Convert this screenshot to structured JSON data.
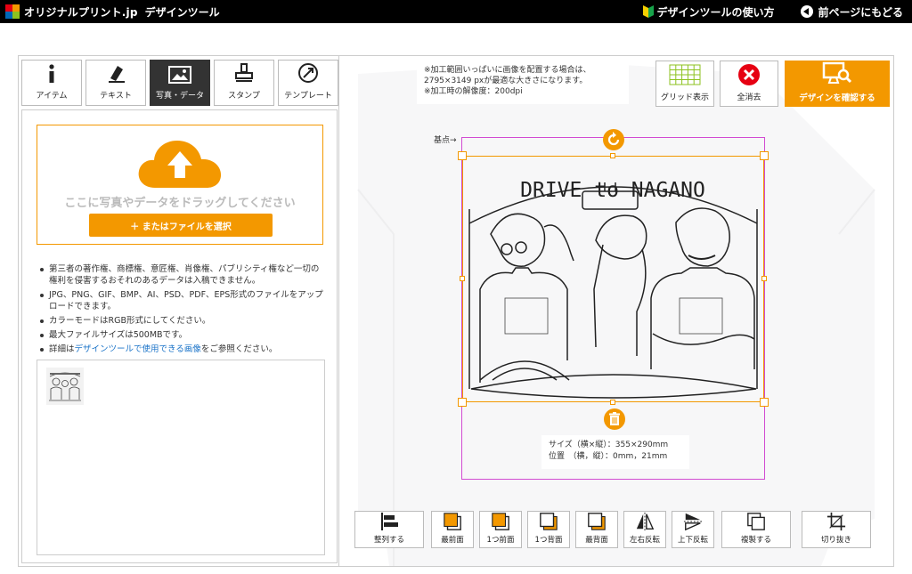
{
  "header": {
    "logo_text": "オリジナルプリント.jp",
    "logo_sub": "デザインツール",
    "guide_link": "デザインツールの使い方",
    "back_link": "前ページにもどる"
  },
  "tabs": [
    {
      "label": "アイテム",
      "icon": "info-icon"
    },
    {
      "label": "テキスト",
      "icon": "pen-icon"
    },
    {
      "label": "写真・データ",
      "icon": "image-icon",
      "active": true
    },
    {
      "label": "スタンプ",
      "icon": "stamp-icon"
    },
    {
      "label": "テンプレート",
      "icon": "template-icon"
    }
  ],
  "upload": {
    "drop_text": "ここに写真やデータをドラッグしてください",
    "file_button": "＋ またはファイルを選択"
  },
  "notes": [
    "第三者の著作権、商標権、意匠権、肖像権、パブリシティ権など一切の権利を侵害するおそれのあるデータは入稿できません。",
    "JPG、PNG、GIF、BMP、AI、PSD、PDF、EPS形式のファイルをアップロードできます。",
    "カラーモードはRGB形式にしてください。",
    "最大ファイルサイズは500MBです。"
  ],
  "notes_last": {
    "prefix": "詳細は",
    "link": "デザインツールで使用できる画像",
    "suffix": "をご参照ください。"
  },
  "canvas": {
    "info_lines": [
      "※加工範囲いっぱいに画像を配置する場合は、",
      "2795×3149 pxが最適な大きさになります。",
      "※加工時の解像度：200dpi"
    ],
    "grid_button": "グリッド表示",
    "clear_button": "全消去",
    "confirm_button": "デザインを確認する",
    "kiten_label": "基点→",
    "design_title": "DRIVE to NAGANO",
    "size_line": "サイズ（横×縦）：355×290mm",
    "position_line": "位置　（横，縦）：0mm，21mm"
  },
  "bottom_tools": [
    {
      "label": "整列する",
      "icon": "align-icon"
    },
    {
      "label": "最前面",
      "icon": "bring-front-icon"
    },
    {
      "label": "1つ前面",
      "icon": "bring-forward-icon"
    },
    {
      "label": "1つ背面",
      "icon": "send-backward-icon"
    },
    {
      "label": "最背面",
      "icon": "send-back-icon"
    },
    {
      "label": "左右反転",
      "icon": "flip-horizontal-icon"
    },
    {
      "label": "上下反転",
      "icon": "flip-vertical-icon"
    },
    {
      "label": "複製する",
      "icon": "duplicate-icon"
    },
    {
      "label": "切り抜き",
      "icon": "crop-icon"
    }
  ],
  "colors": {
    "accent": "#f39800",
    "print_area": "#d24bd2",
    "clear_red": "#e60012",
    "grid_green": "#8dc21f"
  }
}
